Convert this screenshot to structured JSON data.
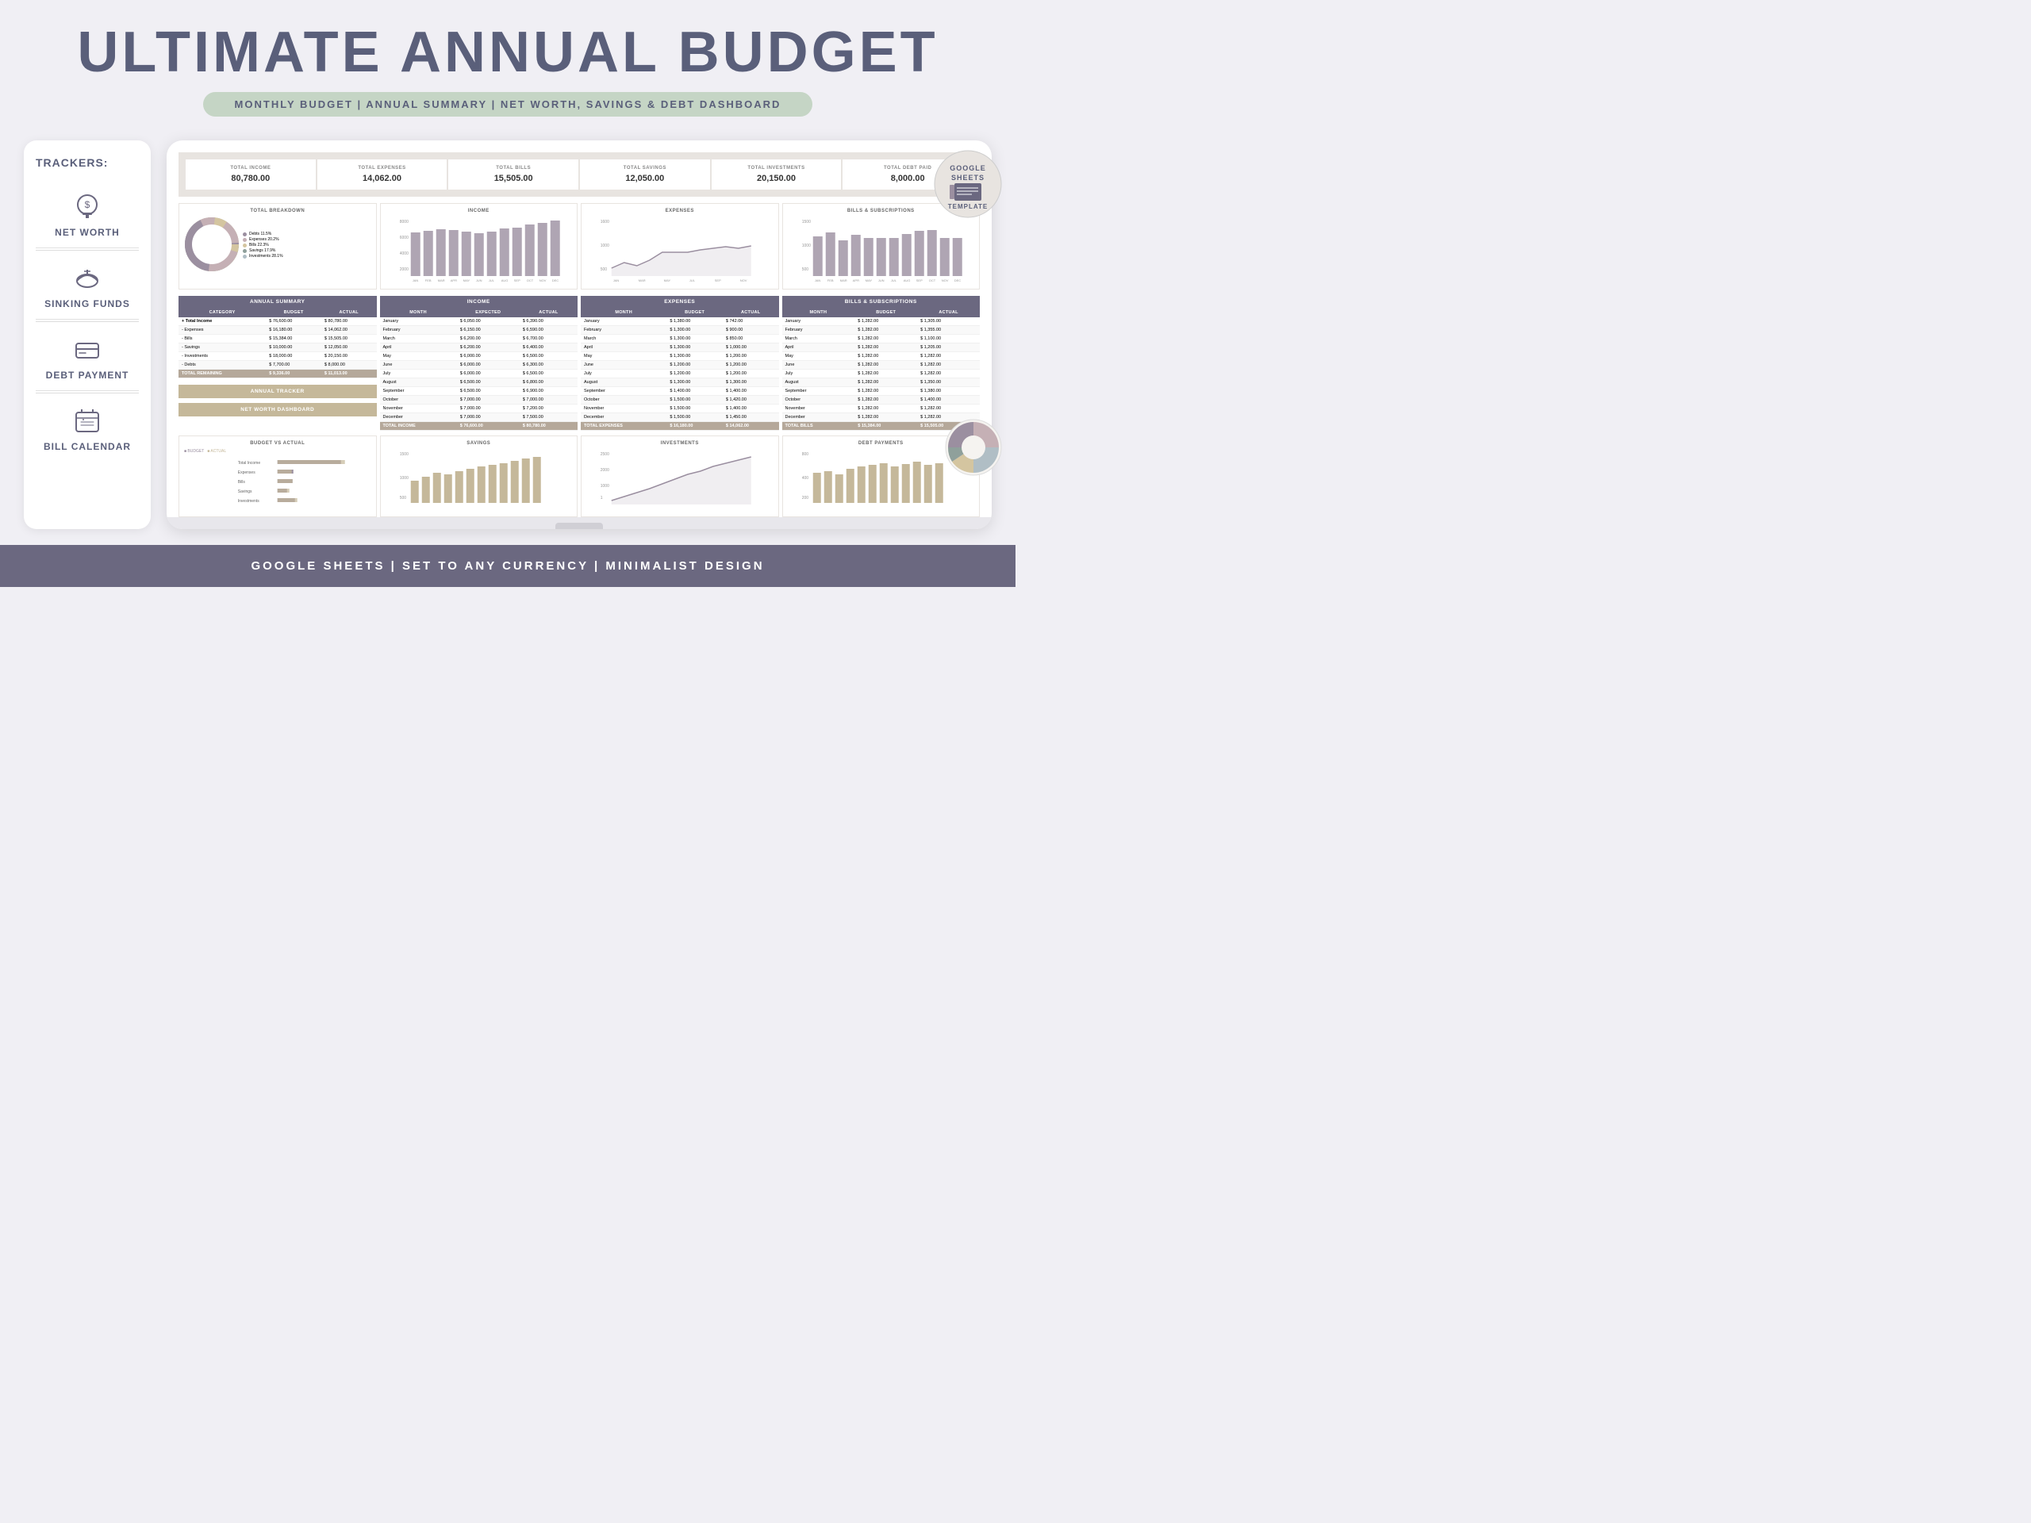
{
  "header": {
    "title": "ULTIMATE ANNUAL BUDGET",
    "subtitle": "MONTHLY BUDGET | ANNUAL SUMMARY | NET WORTH, SAVINGS & DEBT DASHBOARD"
  },
  "sidebar": {
    "trackers_label": "TRACKERS:",
    "items": [
      {
        "id": "net-worth",
        "label": "NET WORTH",
        "icon": "💰"
      },
      {
        "id": "sinking-funds",
        "label": "SINKING FUNDS",
        "icon": "🐷"
      },
      {
        "id": "debt-payment",
        "label": "DEBT PAYMENT",
        "icon": "💳"
      },
      {
        "id": "bill-calendar",
        "label": "BILL CALENDAR",
        "icon": "📋"
      }
    ]
  },
  "summary_cards": [
    {
      "label": "TOTAL INCOME",
      "value": "80,780.00"
    },
    {
      "label": "TOTAL EXPENSES",
      "value": "14,062.00"
    },
    {
      "label": "TOTAL BILLS",
      "value": "15,505.00"
    },
    {
      "label": "TOTAL SAVINGS",
      "value": "12,050.00"
    },
    {
      "label": "TOTAL INVESTMENTS",
      "value": "20,150.00"
    },
    {
      "label": "TOTAL DEBT PAID",
      "value": "8,000.00"
    }
  ],
  "annual_summary": {
    "title": "ANNUAL SUMMARY",
    "headers": [
      "CATEGORY",
      "BUDGET",
      "ACTUAL"
    ],
    "rows": [
      {
        "cat": "+ Total Income",
        "budget": "76,600.00",
        "actual": "80,780.00",
        "bold": true
      },
      {
        "cat": "- Expenses",
        "budget": "16,180.00",
        "actual": "14,062.00"
      },
      {
        "cat": "- Bills",
        "budget": "15,384.00",
        "actual": "15,505.00"
      },
      {
        "cat": "- Savings",
        "budget": "10,000.00",
        "actual": "12,050.00"
      },
      {
        "cat": "- Investments",
        "budget": "18,000.00",
        "actual": "20,150.00"
      },
      {
        "cat": "- Debts",
        "budget": "7,700.00",
        "actual": "8,000.00"
      },
      {
        "cat": "TOTAL REMAINING",
        "budget": "9,336.00",
        "actual": "11,013.00",
        "total": true
      }
    ]
  },
  "income_table": {
    "title": "INCOME",
    "headers": [
      "MONTH",
      "EXPECTED",
      "ACTUAL"
    ],
    "rows": [
      {
        "month": "January",
        "expected": "6,050.00",
        "actual": "6,390.00"
      },
      {
        "month": "February",
        "expected": "6,150.00",
        "actual": "6,590.00"
      },
      {
        "month": "March",
        "expected": "6,200.00",
        "actual": "6,700.00"
      },
      {
        "month": "April",
        "expected": "6,200.00",
        "actual": "6,400.00"
      },
      {
        "month": "May",
        "expected": "6,000.00",
        "actual": "6,500.00"
      },
      {
        "month": "June",
        "expected": "6,000.00",
        "actual": "6,300.00"
      },
      {
        "month": "July",
        "expected": "6,000.00",
        "actual": "6,500.00"
      },
      {
        "month": "August",
        "expected": "6,500.00",
        "actual": "6,800.00"
      },
      {
        "month": "September",
        "expected": "6,500.00",
        "actual": "6,900.00"
      },
      {
        "month": "October",
        "expected": "7,000.00",
        "actual": "7,000.00"
      },
      {
        "month": "November",
        "expected": "7,000.00",
        "actual": "7,200.00"
      },
      {
        "month": "December",
        "expected": "7,000.00",
        "actual": "7,500.00"
      },
      {
        "month": "TOTAL INCOME",
        "expected": "76,600.00",
        "actual": "80,780.00",
        "total": true
      }
    ]
  },
  "expenses_table": {
    "title": "EXPENSES",
    "headers": [
      "MONTH",
      "BUDGET",
      "ACTUAL"
    ],
    "rows": [
      {
        "month": "January",
        "budget": "1,380.00",
        "actual": "742.00"
      },
      {
        "month": "February",
        "budget": "1,300.00",
        "actual": "900.00"
      },
      {
        "month": "March",
        "budget": "1,300.00",
        "actual": "850.00"
      },
      {
        "month": "April",
        "budget": "1,300.00",
        "actual": "1,000.00"
      },
      {
        "month": "May",
        "budget": "1,300.00",
        "actual": "1,200.00"
      },
      {
        "month": "June",
        "budget": "1,200.00",
        "actual": "1,200.00"
      },
      {
        "month": "July",
        "budget": "1,200.00",
        "actual": "1,200.00"
      },
      {
        "month": "August",
        "budget": "1,300.00",
        "actual": "1,300.00"
      },
      {
        "month": "September",
        "budget": "1,400.00",
        "actual": "1,400.00"
      },
      {
        "month": "October",
        "budget": "1,500.00",
        "actual": "1,420.00"
      },
      {
        "month": "November",
        "budget": "1,500.00",
        "actual": "1,400.00"
      },
      {
        "month": "December",
        "budget": "1,500.00",
        "actual": "1,450.00"
      },
      {
        "month": "TOTAL EXPENSES",
        "budget": "16,180.00",
        "actual": "14,062.00",
        "total": true
      }
    ]
  },
  "bills_table": {
    "title": "BILLS & SUBSCRIPTIONS",
    "headers": [
      "MONTH",
      "BUDGET",
      "ACTUAL"
    ],
    "rows": [
      {
        "month": "January",
        "budget": "1,282.00",
        "actual": "1,305.00"
      },
      {
        "month": "February",
        "budget": "1,282.00",
        "actual": "1,355.00"
      },
      {
        "month": "March",
        "budget": "1,282.00",
        "actual": "1,100.00"
      },
      {
        "month": "April",
        "budget": "1,282.00",
        "actual": "1,205.00"
      },
      {
        "month": "May",
        "budget": "1,282.00",
        "actual": "1,282.00"
      },
      {
        "month": "June",
        "budget": "1,282.00",
        "actual": "1,282.00"
      },
      {
        "month": "July",
        "budget": "1,282.00",
        "actual": "1,282.00"
      },
      {
        "month": "August",
        "budget": "1,282.00",
        "actual": "1,350.00"
      },
      {
        "month": "September",
        "budget": "1,282.00",
        "actual": "1,380.00"
      },
      {
        "month": "October",
        "budget": "1,282.00",
        "actual": "1,400.00"
      },
      {
        "month": "November",
        "budget": "1,282.00",
        "actual": "1,282.00"
      },
      {
        "month": "December",
        "budget": "1,282.00",
        "actual": "1,282.00"
      },
      {
        "month": "TOTAL BILLS",
        "budget": "15,384.00",
        "actual": "15,505.00",
        "total": true
      }
    ]
  },
  "footer": {
    "text": "GOOGLE SHEETS | SET TO ANY CURRENCY | MINIMALIST DESIGN"
  },
  "donut": {
    "segments": [
      {
        "label": "Debts 11.5%",
        "color": "#9b8fa0",
        "pct": 11.5
      },
      {
        "label": "Expenses 20.2%",
        "color": "#c5b0b5",
        "pct": 20.2
      },
      {
        "label": "Bills 22.3%",
        "color": "#d4c5a0",
        "pct": 22.3
      },
      {
        "label": "Savings 17.9%",
        "color": "#8fa09b",
        "pct": 17.9
      },
      {
        "label": "Investments 28.1%",
        "color": "#b0bec5",
        "pct": 28.1
      }
    ]
  },
  "tracker_buttons": {
    "annual": "ANNUAL TRACKER",
    "networth": "NET WORTH DASHBOARD"
  },
  "gs_badge": {
    "line1": "GOOGLE",
    "line2": "SHEETS",
    "line3": "TEMPLATE"
  }
}
